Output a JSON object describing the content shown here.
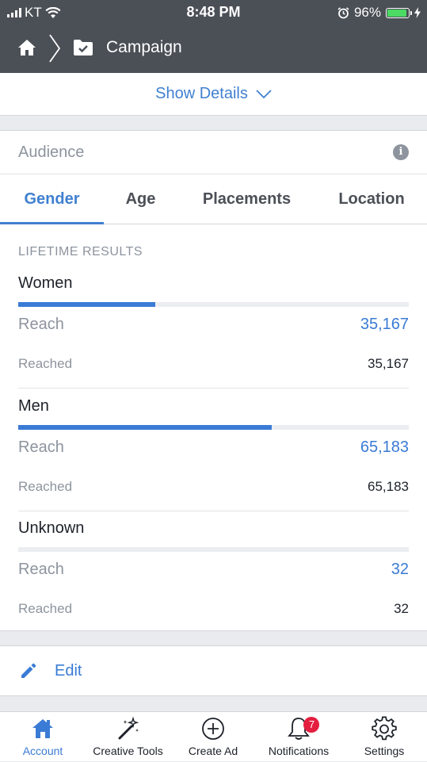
{
  "status_bar": {
    "carrier": "KT",
    "time": "8:48 PM",
    "battery": "96%"
  },
  "nav": {
    "title": "Campaign"
  },
  "show_details": {
    "label": "Show Details"
  },
  "audience": {
    "label": "Audience",
    "tabs": [
      {
        "label": "Gender",
        "active": true
      },
      {
        "label": "Age",
        "active": false
      },
      {
        "label": "Placements",
        "active": false
      },
      {
        "label": "Location",
        "active": false
      }
    ],
    "section_title": "LIFETIME RESULTS",
    "groups": [
      {
        "name": "Women",
        "share": 0.35,
        "reach_label": "Reach",
        "reach_value": "35,167",
        "reached_label": "Reached",
        "reached_value": "35,167"
      },
      {
        "name": "Men",
        "share": 0.65,
        "reach_label": "Reach",
        "reach_value": "65,183",
        "reached_label": "Reached",
        "reached_value": "65,183"
      },
      {
        "name": "Unknown",
        "share": 0.0,
        "reach_label": "Reach",
        "reach_value": "32",
        "reached_label": "Reached",
        "reached_value": "32"
      }
    ]
  },
  "edit": {
    "label": "Edit"
  },
  "tabbar": {
    "items": [
      {
        "label": "Account",
        "icon": "house-icon",
        "active": true
      },
      {
        "label": "Creative Tools",
        "icon": "magic-wand-icon",
        "active": false
      },
      {
        "label": "Create Ad",
        "icon": "plus-circle-icon",
        "active": false
      },
      {
        "label": "Notifications",
        "icon": "bell-icon",
        "active": false,
        "badge": "7"
      },
      {
        "label": "Settings",
        "icon": "gear-icon",
        "active": false
      }
    ]
  },
  "colors": {
    "header_bg": "#4b4f56",
    "accent": "#3a7bd5",
    "badge": "#e41e3f",
    "battery": "#4cd964"
  }
}
